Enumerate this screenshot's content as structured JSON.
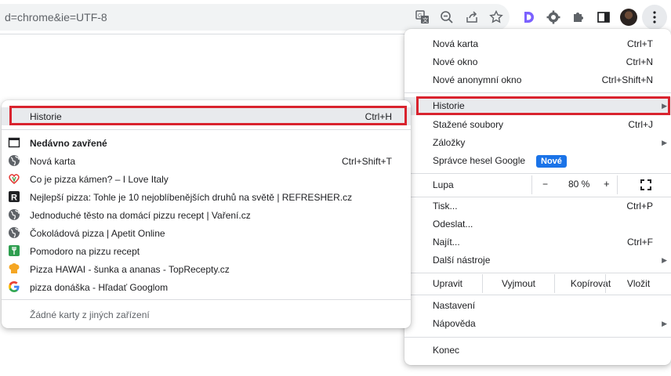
{
  "omnibox": {
    "url": "d=chrome&ie=UTF-8"
  },
  "toolbar": {
    "icons": [
      "translate-icon",
      "zoom-icon",
      "share-icon",
      "bookmark-star-icon",
      "extension-d-icon",
      "extension-gear-icon",
      "extensions-puzzle-icon",
      "side-panel-icon",
      "profile-avatar",
      "menu-kebab-icon"
    ]
  },
  "main_menu": {
    "new_tab": {
      "label": "Nová karta",
      "shortcut": "Ctrl+T"
    },
    "new_window": {
      "label": "Nové okno",
      "shortcut": "Ctrl+N"
    },
    "incognito": {
      "label": "Nové anonymní okno",
      "shortcut": "Ctrl+Shift+N"
    },
    "history": {
      "label": "Historie"
    },
    "downloads": {
      "label": "Stažené soubory",
      "shortcut": "Ctrl+J"
    },
    "bookmarks": {
      "label": "Záložky"
    },
    "passwords": {
      "label": "Správce hesel Google",
      "badge": "Nové"
    },
    "zoom": {
      "label": "Lupa",
      "minus": "−",
      "value": "80 %",
      "plus": "+"
    },
    "print": {
      "label": "Tisk...",
      "shortcut": "Ctrl+P"
    },
    "cast": {
      "label": "Odeslat..."
    },
    "find": {
      "label": "Najít...",
      "shortcut": "Ctrl+F"
    },
    "more_tools": {
      "label": "Další nástroje"
    },
    "edit": {
      "cut": "Upravit",
      "copy": "Vyjmout",
      "paste_label": "Kopírovat",
      "paste": "Vložit"
    },
    "settings": {
      "label": "Nastavení"
    },
    "help": {
      "label": "Nápověda"
    },
    "exit": {
      "label": "Konec"
    }
  },
  "history_submenu": {
    "history": {
      "label": "Historie",
      "shortcut": "Ctrl+H"
    },
    "recently_closed": "Nedávno zavřené",
    "items": [
      {
        "icon": "globe-icon",
        "label": "Nová karta",
        "shortcut": "Ctrl+Shift+T"
      },
      {
        "icon": "heart-favicon",
        "label": "Co je pizza kámen? – I Love Italy"
      },
      {
        "icon": "refresher-favicon",
        "label": "Nejlepší pizza: Tohle je 10 nejoblíbenějších druhů na světě | REFRESHER.cz"
      },
      {
        "icon": "globe-icon",
        "label": "Jednoduché těsto na domácí pizzu recept | Vaření.cz"
      },
      {
        "icon": "globe-icon",
        "label": "Čokoládová pizza | Apetit Online"
      },
      {
        "icon": "fork-favicon",
        "label": "Pomodoro na pizzu recept"
      },
      {
        "icon": "chef-hat-favicon",
        "label": "Pizza HAWAI - šunka a ananas - TopRecepty.cz"
      },
      {
        "icon": "google-icon",
        "label": "pizza donáška - Hľadať Googlom"
      }
    ],
    "no_other_devices": "Žádné karty z jiných zařízení"
  },
  "colors": {
    "highlight_border": "#d9232e",
    "hover_bg": "#e8eaed",
    "badge_bg": "#1a73e8",
    "accent_d": "#7b61ff"
  }
}
